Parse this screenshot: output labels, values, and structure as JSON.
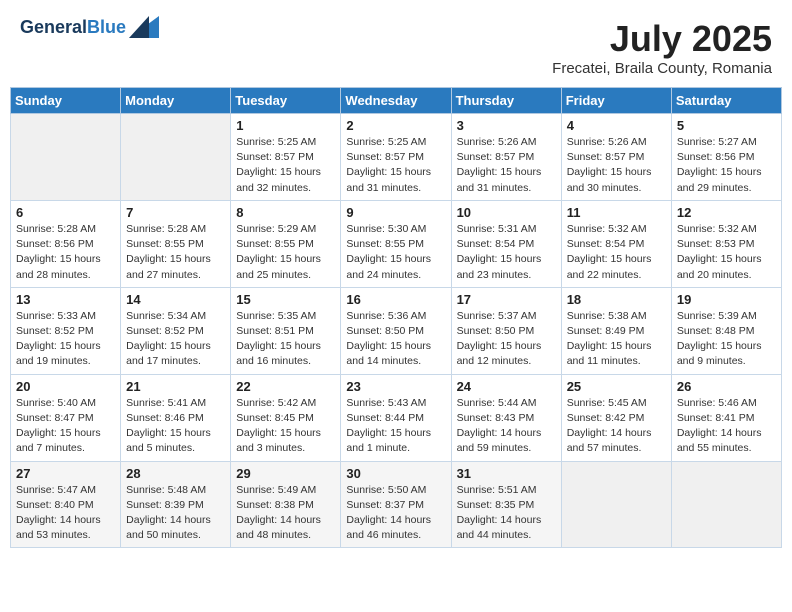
{
  "header": {
    "logo_line1": "General",
    "logo_line2": "Blue",
    "month": "July 2025",
    "location": "Frecatei, Braila County, Romania"
  },
  "weekdays": [
    "Sunday",
    "Monday",
    "Tuesday",
    "Wednesday",
    "Thursday",
    "Friday",
    "Saturday"
  ],
  "weeks": [
    [
      {
        "day": "",
        "info": ""
      },
      {
        "day": "",
        "info": ""
      },
      {
        "day": "1",
        "info": "Sunrise: 5:25 AM\nSunset: 8:57 PM\nDaylight: 15 hours and 32 minutes."
      },
      {
        "day": "2",
        "info": "Sunrise: 5:25 AM\nSunset: 8:57 PM\nDaylight: 15 hours and 31 minutes."
      },
      {
        "day": "3",
        "info": "Sunrise: 5:26 AM\nSunset: 8:57 PM\nDaylight: 15 hours and 31 minutes."
      },
      {
        "day": "4",
        "info": "Sunrise: 5:26 AM\nSunset: 8:57 PM\nDaylight: 15 hours and 30 minutes."
      },
      {
        "day": "5",
        "info": "Sunrise: 5:27 AM\nSunset: 8:56 PM\nDaylight: 15 hours and 29 minutes."
      }
    ],
    [
      {
        "day": "6",
        "info": "Sunrise: 5:28 AM\nSunset: 8:56 PM\nDaylight: 15 hours and 28 minutes."
      },
      {
        "day": "7",
        "info": "Sunrise: 5:28 AM\nSunset: 8:55 PM\nDaylight: 15 hours and 27 minutes."
      },
      {
        "day": "8",
        "info": "Sunrise: 5:29 AM\nSunset: 8:55 PM\nDaylight: 15 hours and 25 minutes."
      },
      {
        "day": "9",
        "info": "Sunrise: 5:30 AM\nSunset: 8:55 PM\nDaylight: 15 hours and 24 minutes."
      },
      {
        "day": "10",
        "info": "Sunrise: 5:31 AM\nSunset: 8:54 PM\nDaylight: 15 hours and 23 minutes."
      },
      {
        "day": "11",
        "info": "Sunrise: 5:32 AM\nSunset: 8:54 PM\nDaylight: 15 hours and 22 minutes."
      },
      {
        "day": "12",
        "info": "Sunrise: 5:32 AM\nSunset: 8:53 PM\nDaylight: 15 hours and 20 minutes."
      }
    ],
    [
      {
        "day": "13",
        "info": "Sunrise: 5:33 AM\nSunset: 8:52 PM\nDaylight: 15 hours and 19 minutes."
      },
      {
        "day": "14",
        "info": "Sunrise: 5:34 AM\nSunset: 8:52 PM\nDaylight: 15 hours and 17 minutes."
      },
      {
        "day": "15",
        "info": "Sunrise: 5:35 AM\nSunset: 8:51 PM\nDaylight: 15 hours and 16 minutes."
      },
      {
        "day": "16",
        "info": "Sunrise: 5:36 AM\nSunset: 8:50 PM\nDaylight: 15 hours and 14 minutes."
      },
      {
        "day": "17",
        "info": "Sunrise: 5:37 AM\nSunset: 8:50 PM\nDaylight: 15 hours and 12 minutes."
      },
      {
        "day": "18",
        "info": "Sunrise: 5:38 AM\nSunset: 8:49 PM\nDaylight: 15 hours and 11 minutes."
      },
      {
        "day": "19",
        "info": "Sunrise: 5:39 AM\nSunset: 8:48 PM\nDaylight: 15 hours and 9 minutes."
      }
    ],
    [
      {
        "day": "20",
        "info": "Sunrise: 5:40 AM\nSunset: 8:47 PM\nDaylight: 15 hours and 7 minutes."
      },
      {
        "day": "21",
        "info": "Sunrise: 5:41 AM\nSunset: 8:46 PM\nDaylight: 15 hours and 5 minutes."
      },
      {
        "day": "22",
        "info": "Sunrise: 5:42 AM\nSunset: 8:45 PM\nDaylight: 15 hours and 3 minutes."
      },
      {
        "day": "23",
        "info": "Sunrise: 5:43 AM\nSunset: 8:44 PM\nDaylight: 15 hours and 1 minute."
      },
      {
        "day": "24",
        "info": "Sunrise: 5:44 AM\nSunset: 8:43 PM\nDaylight: 14 hours and 59 minutes."
      },
      {
        "day": "25",
        "info": "Sunrise: 5:45 AM\nSunset: 8:42 PM\nDaylight: 14 hours and 57 minutes."
      },
      {
        "day": "26",
        "info": "Sunrise: 5:46 AM\nSunset: 8:41 PM\nDaylight: 14 hours and 55 minutes."
      }
    ],
    [
      {
        "day": "27",
        "info": "Sunrise: 5:47 AM\nSunset: 8:40 PM\nDaylight: 14 hours and 53 minutes."
      },
      {
        "day": "28",
        "info": "Sunrise: 5:48 AM\nSunset: 8:39 PM\nDaylight: 14 hours and 50 minutes."
      },
      {
        "day": "29",
        "info": "Sunrise: 5:49 AM\nSunset: 8:38 PM\nDaylight: 14 hours and 48 minutes."
      },
      {
        "day": "30",
        "info": "Sunrise: 5:50 AM\nSunset: 8:37 PM\nDaylight: 14 hours and 46 minutes."
      },
      {
        "day": "31",
        "info": "Sunrise: 5:51 AM\nSunset: 8:35 PM\nDaylight: 14 hours and 44 minutes."
      },
      {
        "day": "",
        "info": ""
      },
      {
        "day": "",
        "info": ""
      }
    ]
  ]
}
